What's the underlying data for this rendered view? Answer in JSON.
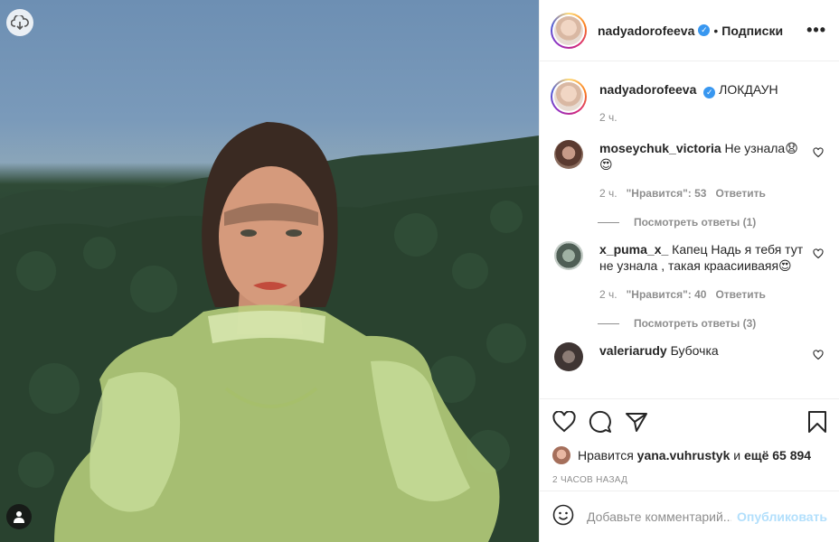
{
  "post": {
    "username": "nadyadorofeeva",
    "follow_label": "Подписки",
    "separator": "•",
    "more": "•••",
    "caption": "ЛОКДАУН",
    "caption_time": "2 ч."
  },
  "comments": [
    {
      "username": "moseychuk_victoria",
      "text": "Не узнала😧😍",
      "time": "2 ч.",
      "likes": "\"Нравится\": 53",
      "reply_label": "Ответить",
      "view_replies": "Посмотреть ответы (1)"
    },
    {
      "username": "x_puma_x_",
      "text": "Капец Надь я тебя тут не узнала , такая краасииваяя😍",
      "time": "2 ч.",
      "likes": "\"Нравится\": 40",
      "reply_label": "Ответить",
      "view_replies": "Посмотреть ответы (3)"
    },
    {
      "username": "valeriarudy",
      "text": "Бубочка"
    }
  ],
  "likes": {
    "prefix": "Нравится",
    "user": "yana.vuhrustyk",
    "conj": "и",
    "others": "ещё 65 894"
  },
  "timestamp": "2 ЧАСОВ НАЗАД",
  "add_comment": {
    "placeholder": "Добавьте комментарий...",
    "publish": "Опубликовать"
  },
  "icons": {
    "download": "download-cloud-icon",
    "tag": "user-tag-icon",
    "like": "heart-icon",
    "comment": "comment-icon",
    "share": "send-icon",
    "save": "bookmark-icon",
    "emoji": "emoji-icon",
    "more": "more-dots-icon",
    "verified": "verified-icon"
  }
}
